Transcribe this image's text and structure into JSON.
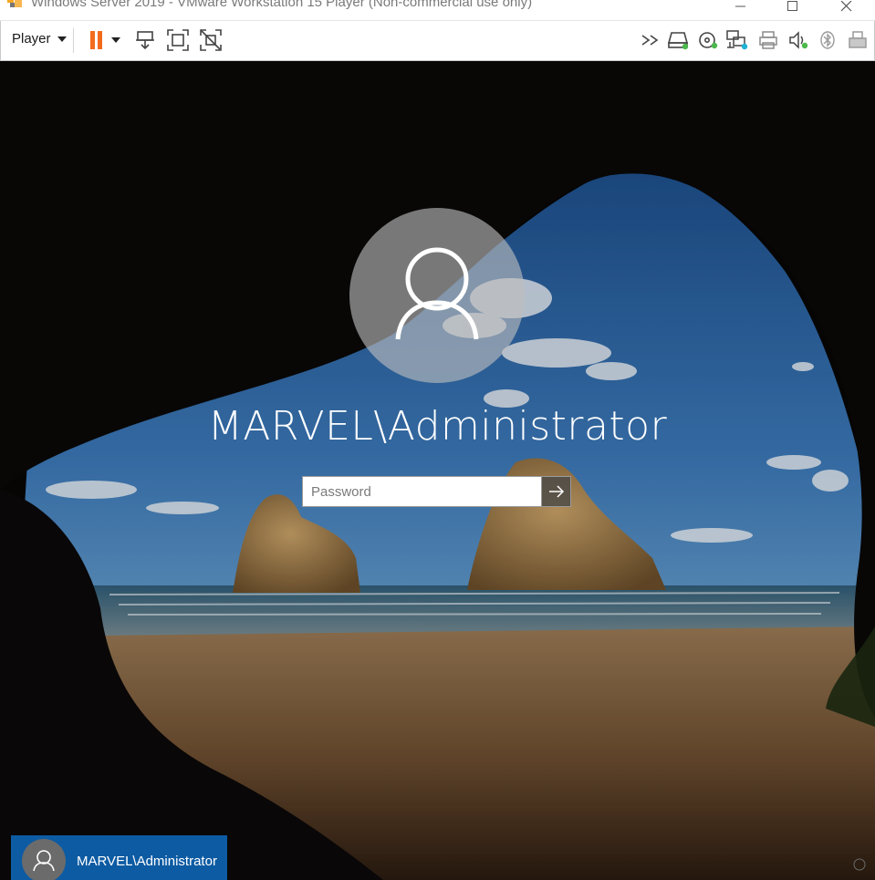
{
  "window": {
    "title": "Windows Server 2019 - VMware Workstation 15 Player (Non-commercial use only)"
  },
  "toolbar": {
    "player_label": "Player",
    "icons": [
      "pause-icon",
      "send-ctrl-alt-del-icon",
      "fullscreen-icon",
      "unity-icon",
      "forward-icon",
      "hard-disk-icon",
      "cd-dvd-icon",
      "network-adapter-icon",
      "printer-icon",
      "sound-icon",
      "bluetooth-icon",
      "usb-icon"
    ]
  },
  "login": {
    "username": "MARVEL\\Administrator",
    "password_placeholder": "Password"
  },
  "user_tile": {
    "name": "MARVEL\\Administrator"
  },
  "colors": {
    "pause_accent": "#f26b1d",
    "device_connected": "#4cb84c",
    "user_tile_bg": "#0d5ba3"
  }
}
